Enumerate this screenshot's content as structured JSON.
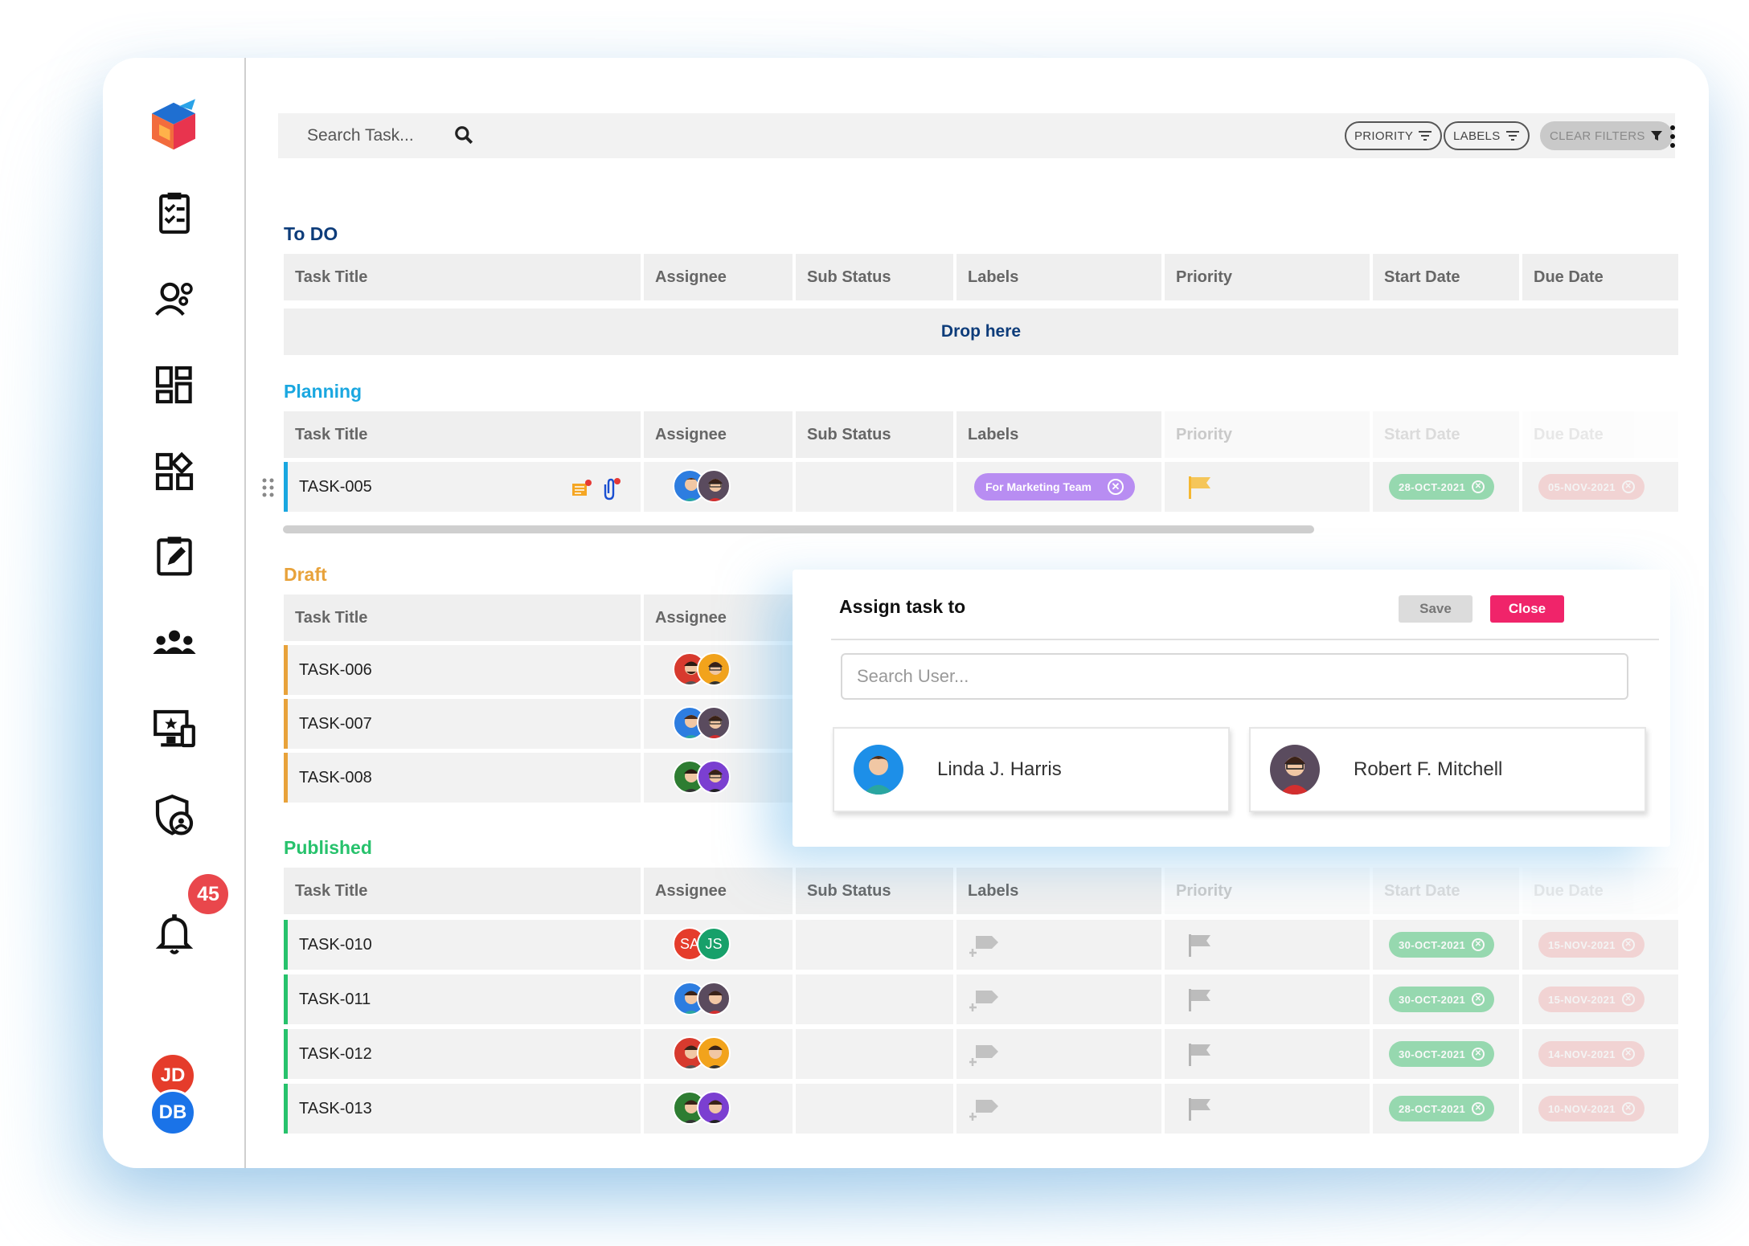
{
  "toolbar": {
    "search_placeholder": "Search Task...",
    "priority_label": "PRIORITY",
    "labels_label": "LABELS",
    "clear_filters_label": "CLEAR FILTERS"
  },
  "sidebar": {
    "notification_count": "45",
    "users": [
      {
        "initials": "JD",
        "color": "#e53c2b"
      },
      {
        "initials": "DB",
        "color": "#1a73e8"
      }
    ]
  },
  "columns": [
    "Task Title",
    "Assignee",
    "Sub Status",
    "Labels",
    "Priority",
    "Start Date",
    "Due Date"
  ],
  "sections": {
    "todo": {
      "title": "To DO",
      "color": "#0d3c7a",
      "drop_text": "Drop here"
    },
    "planning": {
      "title": "Planning",
      "color": "#1aa7e0",
      "rows": [
        {
          "id": "TASK-005",
          "label": "For Marketing Team",
          "start": "28-OCT-2021",
          "due": "05-NOV-2021"
        }
      ]
    },
    "draft": {
      "title": "Draft",
      "color": "#e8a23a",
      "rows": [
        {
          "id": "TASK-006"
        },
        {
          "id": "TASK-007"
        },
        {
          "id": "TASK-008"
        }
      ]
    },
    "published": {
      "title": "Published",
      "color": "#27c26c",
      "rows": [
        {
          "id": "TASK-010",
          "start": "30-OCT-2021",
          "due": "15-NOV-2021",
          "assignees": [
            "SA",
            "JS"
          ]
        },
        {
          "id": "TASK-011",
          "start": "30-OCT-2021",
          "due": "15-NOV-2021"
        },
        {
          "id": "TASK-012",
          "start": "30-OCT-2021",
          "due": "14-NOV-2021"
        },
        {
          "id": "TASK-013",
          "start": "28-OCT-2021",
          "due": "10-NOV-2021"
        }
      ]
    }
  },
  "dialog": {
    "title": "Assign task to",
    "save_label": "Save",
    "close_label": "Close",
    "search_placeholder": "Search User...",
    "users": [
      "Linda J. Harris",
      "Robert F. Mitchell"
    ]
  },
  "colors": {
    "start_chip": "#4cc47a",
    "due_chip": "#f06a6a",
    "close_button": "#f0246a",
    "priority_flag": "#f5b731"
  }
}
